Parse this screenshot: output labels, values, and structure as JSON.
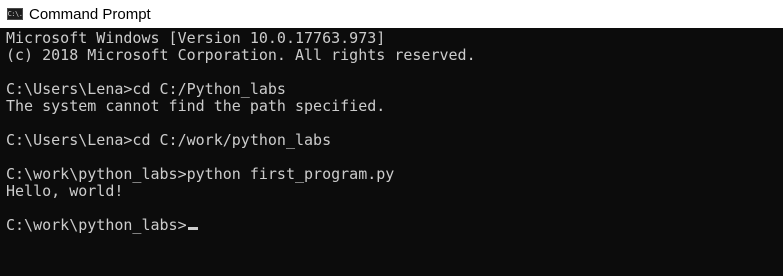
{
  "window": {
    "title": "Command Prompt",
    "icon": "cmd-icon",
    "icon_text": "C:\\."
  },
  "console": {
    "lines": [
      "Microsoft Windows [Version 10.0.17763.973]",
      "(c) 2018 Microsoft Corporation. All rights reserved.",
      "",
      "C:\\Users\\Lena>cd C:/Python_labs",
      "The system cannot find the path specified.",
      "",
      "C:\\Users\\Lena>cd C:/work/python_labs",
      "",
      "C:\\work\\python_labs>python first_program.py",
      "Hello, world!",
      "",
      "C:\\work\\python_labs>"
    ]
  },
  "colors": {
    "background": "#0c0c0c",
    "foreground": "#cccccc",
    "titlebar": "#ffffff"
  }
}
